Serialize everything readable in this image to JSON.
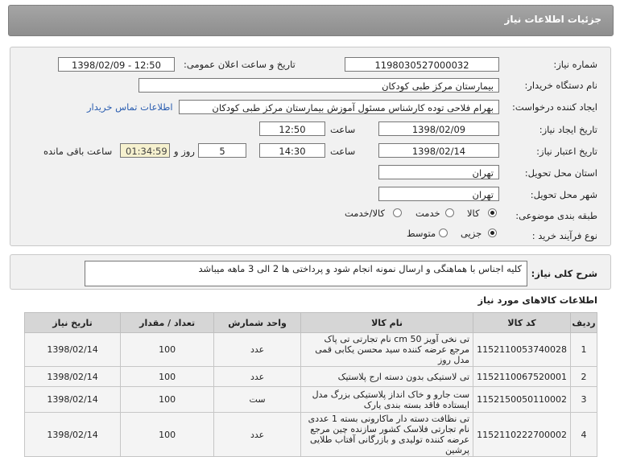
{
  "header": {
    "title": "جزئیات اطلاعات نیاز"
  },
  "form": {
    "need_number_label": "شماره نیاز:",
    "need_number": "1198030527000032",
    "announce_label": "تاریخ و ساعت اعلان عمومی:",
    "announce_value": "1398/02/09 - 12:50",
    "buyer_label": "نام دستگاه خریدار:",
    "buyer_value": "بیمارستان مرکز طبی کودکان",
    "creator_label": "ایجاد کننده درخواست:",
    "creator_value": "بهرام فلاحی توده کارشناس مسئول آموزش بیمارستان مرکز طبی کودکان",
    "contact_link": "اطلاعات تماس خریدار",
    "created_label": "تاریخ ایجاد نیاز:",
    "created_date": "1398/02/09",
    "hour_label": "ساعت",
    "created_time": "12:50",
    "valid_label": "تاریخ اعتبار نیاز:",
    "valid_date": "1398/02/14",
    "valid_time": "14:30",
    "days": "5",
    "days_label": "روز و",
    "remaining_time": "01:34:59",
    "remaining_label": "ساعت باقی مانده",
    "province_label": "استان محل تحویل:",
    "province_value": "تهران",
    "city_label": "شهر محل تحویل:",
    "city_value": "تهران",
    "category_label": "طبقه بندی موضوعی:",
    "cat_goods": "کالا",
    "cat_service": "خدمت",
    "cat_both": "کالا/خدمت",
    "process_label": "نوع فرآیند خرید :",
    "proc_partial": "جزیی",
    "proc_medium": "متوسط"
  },
  "summary": {
    "label": "شرح کلی نیاز:",
    "text": "کلیه اجناس با هماهنگی و ارسال نمونه انجام شود و پرداختی ها 2 الی 3 ماهه میباشد"
  },
  "goods": {
    "title": "اطلاعات کالاهای مورد نیاز",
    "headers": [
      "ردیف",
      "کد کالا",
      "نام کالا",
      "واحد شمارش",
      "تعداد / مقدار",
      "تاریخ نیاز"
    ],
    "rows": [
      [
        "1",
        "1152110053740028",
        "تی نخی آویز 50 cm نام تجارتی تی پاک مرجع عرضه کننده سید محسن یکابی قمی مدل روز",
        "عدد",
        "100",
        "1398/02/14"
      ],
      [
        "2",
        "1152110067520001",
        "تی لاستیکی بدون دسته ارج پلاستیک",
        "عدد",
        "100",
        "1398/02/14"
      ],
      [
        "3",
        "1152150050110002",
        "ست جارو و خاک انداز پلاستیکی بزرگ مدل ایستاده فاقد بسته بندی یارک",
        "ست",
        "100",
        "1398/02/14"
      ],
      [
        "4",
        "1152110222700002",
        "تی نظافت دسته دار ماکارونی بسته 1 عددی نام تجارتی فلاسک کشور سازنده چین مرجع عرضه کننده تولیدی و بازرگانی آفتاب طلایی پرشین",
        "عدد",
        "100",
        "1398/02/14"
      ]
    ]
  }
}
